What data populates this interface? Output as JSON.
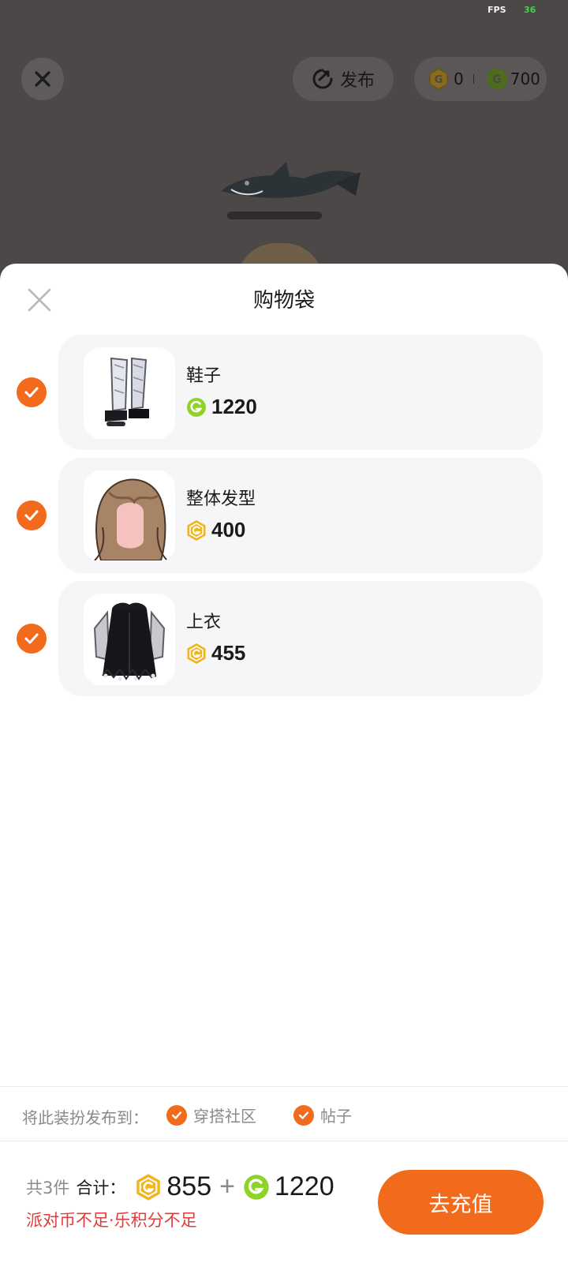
{
  "status": {
    "fps_label": "FPS",
    "fps_value": "36"
  },
  "scene": {
    "publish_label": "发布",
    "wallet": {
      "party_coins": "0",
      "le_points": "700"
    }
  },
  "sheet": {
    "title": "购物袋",
    "items": [
      {
        "name": "鞋子",
        "currency": "le-points",
        "price": "1220",
        "checked": true
      },
      {
        "name": "整体发型",
        "currency": "party-coins",
        "price": "400",
        "checked": true
      },
      {
        "name": "上衣",
        "currency": "party-coins",
        "price": "455",
        "checked": true
      }
    ]
  },
  "publish_to": {
    "label": "将此装扮发布到：",
    "options": [
      {
        "label": "穿搭社区",
        "checked": true
      },
      {
        "label": "帖子",
        "checked": true
      }
    ]
  },
  "footer": {
    "count_text": "共3件",
    "total_label": "合计：",
    "party_coin_total": "855",
    "plus": "+",
    "le_point_total": "1220",
    "warning": "派对币不足·乐积分不足",
    "recharge_label": "去充值"
  },
  "colors": {
    "accent_orange": "#f26b1d",
    "party_coin_gold": "#f0b51f",
    "le_point_green": "#8fd22a",
    "warning_red": "#e23b3b"
  }
}
